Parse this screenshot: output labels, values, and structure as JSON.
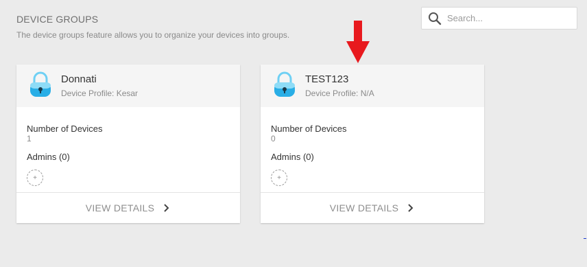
{
  "header": {
    "title": "DEVICE GROUPS",
    "subtitle": "The device groups feature allows you to organize your devices into groups."
  },
  "search": {
    "placeholder": "Search..."
  },
  "colors": {
    "background": "#ebebeb",
    "card_header": "#f5f5f5",
    "arrow": "#e8191e",
    "lock_blue": "#29aee6"
  },
  "groups": [
    {
      "name": "Donnati",
      "profile": "Device Profile: Kesar",
      "devices_label": "Number of Devices",
      "devices_count": "1",
      "admins_label": "Admins (0)",
      "add_glyph": "+",
      "action_label": "VIEW DETAILS"
    },
    {
      "name": "TEST123",
      "profile": "Device Profile: N/A",
      "devices_label": "Number of Devices",
      "devices_count": "0",
      "admins_label": "Admins (0)",
      "add_glyph": "+",
      "action_label": "VIEW DETAILS"
    }
  ]
}
